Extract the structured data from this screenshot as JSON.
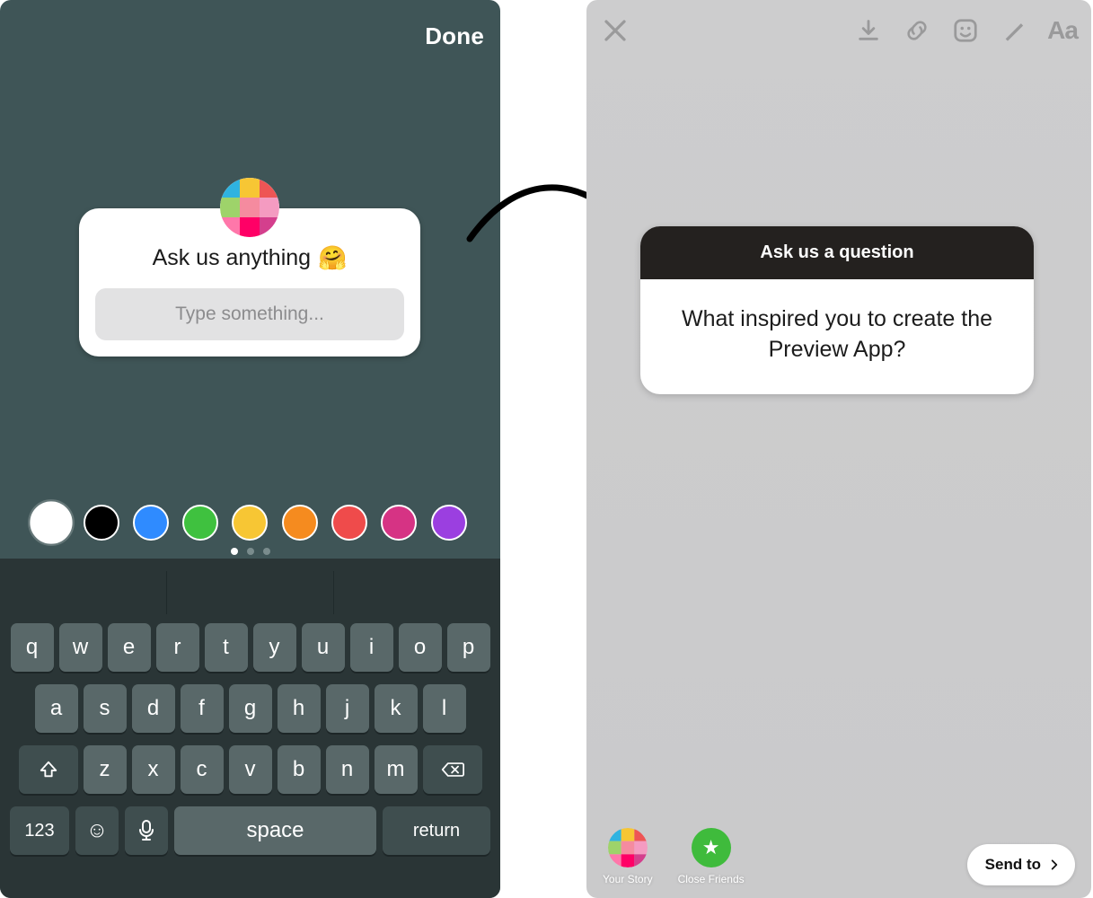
{
  "left": {
    "done_label": "Done",
    "question": {
      "prompt": "Ask us anything",
      "emoji": "🤗",
      "placeholder": "Type something..."
    },
    "colors": [
      {
        "name": "white",
        "hex": "#ffffff",
        "selected": true
      },
      {
        "name": "black",
        "hex": "#000000"
      },
      {
        "name": "blue",
        "hex": "#2f8bff"
      },
      {
        "name": "green",
        "hex": "#3fc13f"
      },
      {
        "name": "yellow",
        "hex": "#f7c634"
      },
      {
        "name": "orange",
        "hex": "#f58b1f"
      },
      {
        "name": "red",
        "hex": "#ef4b4b"
      },
      {
        "name": "magenta",
        "hex": "#d63384"
      },
      {
        "name": "purple",
        "hex": "#9b3fe0"
      }
    ],
    "page_dots": {
      "count": 3,
      "active": 0
    },
    "keyboard": {
      "row1": [
        "q",
        "w",
        "e",
        "r",
        "t",
        "y",
        "u",
        "i",
        "o",
        "p"
      ],
      "row2": [
        "a",
        "s",
        "d",
        "f",
        "g",
        "h",
        "j",
        "k",
        "l"
      ],
      "row3": [
        "z",
        "x",
        "c",
        "v",
        "b",
        "n",
        "m"
      ],
      "numeric_label": "123",
      "space_label": "space",
      "return_label": "return"
    }
  },
  "right": {
    "tools_text_label": "Aa",
    "answer": {
      "header": "Ask us a question",
      "body": "What inspired you to create the Preview App?"
    },
    "share": {
      "your_story": "Your Story",
      "close_friends": "Close Friends",
      "send_to": "Send to"
    }
  }
}
